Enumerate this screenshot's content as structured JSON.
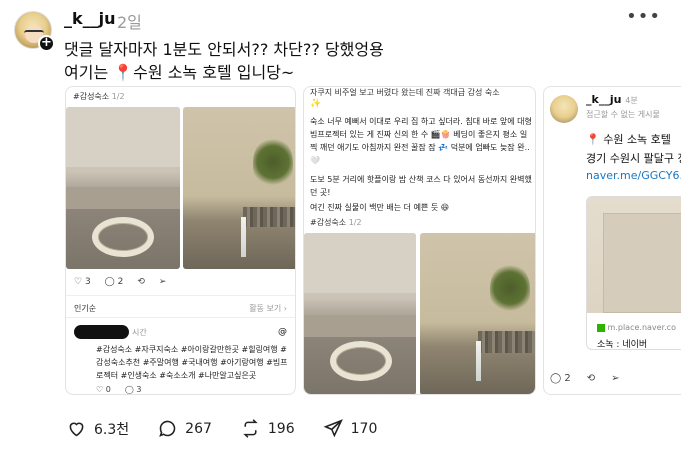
{
  "post": {
    "username": "_k__ju",
    "time": "2일",
    "line1": "댓글 달자마자 1분도 안되서?? 차단?? 당했엉용",
    "line2_prefix": "여기는 ",
    "line2_pin": "📍",
    "line2_rest": "수원 소녹 호텔 입니당~"
  },
  "card1": {
    "tag": "#감성숙소",
    "counter": "1/2",
    "stats": {
      "likes": "3",
      "comments": "2"
    },
    "popular_label": "인기순",
    "see_activity": "활동 보기",
    "time_label": "시간",
    "hashtags": "#감성숙소 #자쿠지숙소 #아이랑갈만한곳 #힐링여행 #감성숙소추천 #주말여행 #국내여행 #아기랑여행 #빔프로젝터 #인생숙소 #숙소소개 #나만알고싶은곳",
    "footer_counts": {
      "a": "0",
      "b": "3"
    }
  },
  "card2": {
    "text_top": "자쿠지 비주얼 보고 버렸다 왔는데 진짜 객대급 감성 숙소",
    "text_body": "숙소 너무 예뻐서 이대로 우리 집 하고 싶더라. 침대 바로 앞에 대형 빔프로젝터 있는 게 진짜 신의 한 수 🎬🍿 베딩이 좋은지 평소 일찍 깨던 애기도 아침까지 완전 꿀잠 잠 💤 덕분에 엄빠도 늦잠 완..🤍",
    "text_body2": "도보 5분 거리에 핫플이랑 밤 산책 코스 다 있어서 동선까지 완벽했던 곳!",
    "text_body3": "여긴 진짜 실물이 백만 배는 더 예쁜 듯 😆",
    "tag": "#감성숙소",
    "counter": "1/2"
  },
  "card3": {
    "username": "_k__ju",
    "time": "4분",
    "note": "접근할 수 없는 게시물",
    "place_pin": "📍",
    "place_name": "수원 소녹 호텔",
    "address": "경기 수원시 팔달구 정",
    "link": "naver.me/GGCY6...",
    "domain": "m.place.naver.co",
    "link_title": "소녹 : 네이버",
    "stats": {
      "comments": "2"
    }
  },
  "actions": {
    "likes": "6.3천",
    "comments": "267",
    "reposts": "196",
    "shares": "170"
  },
  "icons": [
    "heart-icon",
    "comment-icon",
    "repost-icon",
    "share-icon",
    "more-icon",
    "plus-icon"
  ]
}
